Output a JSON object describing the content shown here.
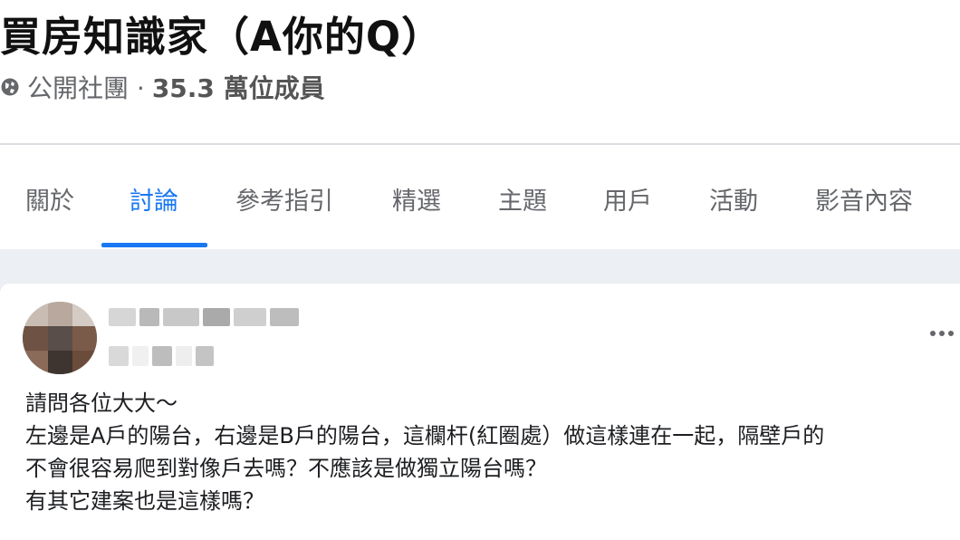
{
  "group": {
    "title": "買房知識家（A你的Q）",
    "privacy": "公開社團 ·",
    "members": "35.3 萬位成員"
  },
  "tabs": [
    {
      "label": "關於",
      "active": false
    },
    {
      "label": "討論",
      "active": true
    },
    {
      "label": "參考指引",
      "active": false
    },
    {
      "label": "精選",
      "active": false
    },
    {
      "label": "主題",
      "active": false
    },
    {
      "label": "用戶",
      "active": false
    },
    {
      "label": "活動",
      "active": false
    },
    {
      "label": "影音內容",
      "active": false
    }
  ],
  "post": {
    "lines": [
      "請問各位大大～",
      "左邊是A戶的陽台，右邊是B戶的陽台，這欄杆(紅圈處）做這樣連在一起，隔壁戶的",
      "不會很容易爬到對像戶去嗎？不應該是做獨立陽台嗎？",
      "有其它建案也是這樣嗎？"
    ],
    "more_icon": "more-horizontal-icon"
  },
  "colors": {
    "accent": "#1877f2",
    "muted": "#65676b",
    "feed_bg": "#eceff3"
  }
}
